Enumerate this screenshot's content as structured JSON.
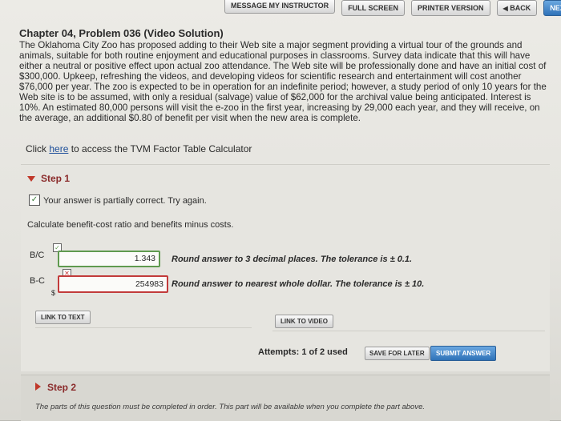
{
  "toolbar": {
    "message_instructor": "MESSAGE MY INSTRUCTOR",
    "full_screen": "FULL SCREEN",
    "printer_version": "PRINTER VERSION",
    "back": "BACK",
    "next": "NEXT"
  },
  "problem": {
    "title": "Chapter 04, Problem 036 (Video Solution)",
    "text": "The Oklahoma City Zoo has proposed adding to their Web site a major segment providing a virtual tour of the grounds and animals, suitable for both routine enjoyment and educational purposes in classrooms. Survey data indicate that this will have either a neutral or positive effect upon actual zoo attendance. The Web site will be professionally done and have an initial cost of $300,000. Upkeep, refreshing the videos, and developing videos for scientific research and entertainment will cost another $76,000 per year. The zoo is expected to be in operation for an indefinite period; however, a study period of only 10 years for the Web site is to be assumed, with only a residual (salvage) value of $62,000 for the archival value being anticipated. Interest is 10%. An estimated 80,000 persons will visit the e-zoo in the first year, increasing by 29,000 each year, and they will receive, on the average, an additional $0.80 of benefit per visit when the new area is complete.",
    "click_prefix": "Click ",
    "click_link": "here",
    "click_suffix": " to access the TVM Factor Table Calculator"
  },
  "step1": {
    "label": "Step 1",
    "status_message": "Your answer is partially correct.  Try again.",
    "instruction": "Calculate benefit-cost ratio and benefits minus costs.",
    "bc_label": "B/C",
    "bc_value": "1.343",
    "bc_round": "Round answer to 3 decimal places. The tolerance is ± 0.1.",
    "bmc_label": "B-C",
    "bmc_currency": "$",
    "bmc_value": "254983",
    "bmc_round": "Round answer to nearest whole dollar. The tolerance is ± 10.",
    "link_text": "LINK TO TEXT",
    "link_video": "LINK TO VIDEO",
    "attempts": "Attempts: 1 of 2 used",
    "save_later": "SAVE FOR LATER",
    "submit": "SUBMIT ANSWER"
  },
  "step2": {
    "label": "Step 2",
    "note": "The parts of this question must be completed in order. This part will be available when you complete the part above."
  },
  "colors": {
    "correct": "#5f9a4f",
    "incorrect": "#c23b3b",
    "accent_blue": "#2f72b8",
    "step_caret": "#c0392b"
  }
}
